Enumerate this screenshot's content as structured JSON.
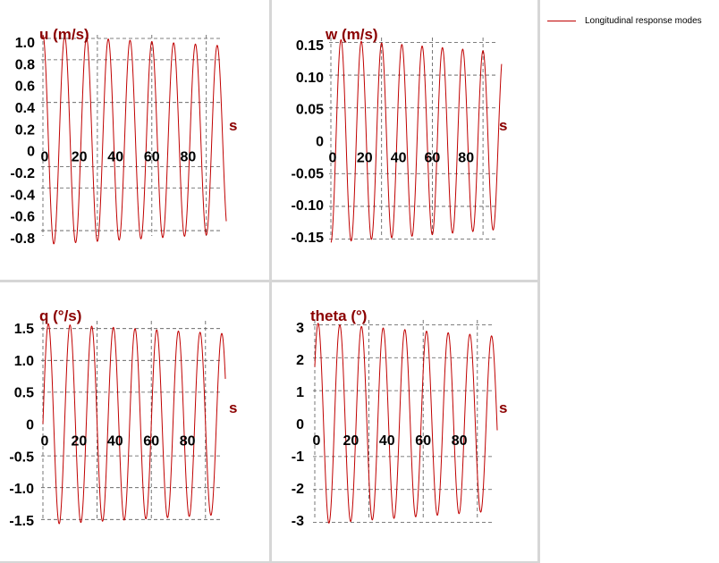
{
  "legend": {
    "label": "Longitudinal response modes",
    "color": "#c00000"
  },
  "style": {
    "title_color": "#8b0000",
    "line_color": "#c00000",
    "grid_color": "#555555",
    "tick_color": "#000000"
  },
  "charts": [
    {
      "id": "u",
      "chart_data": {
        "type": "line",
        "title": "u (m/s)",
        "xlabel": "s",
        "ylabel": "",
        "xlim": [
          0,
          100
        ],
        "ylim": [
          -1.0,
          1.0
        ],
        "xticks": [
          "0",
          "20",
          "40",
          "60",
          "80"
        ],
        "yticks": [
          "1.0",
          "0.8",
          "0.6",
          "0.4",
          "0.2",
          "0",
          "-0.2",
          "-0.4",
          "-0.6",
          "-0.8"
        ],
        "x_grid": [
          0,
          30,
          60,
          90
        ],
        "y_grid": [
          0.95,
          0.75,
          0.35,
          -0.25,
          -0.45,
          -0.85
        ],
        "series": [
          {
            "name": "Longitudinal response modes",
            "wave": {
              "amplitude_start": 0.98,
              "amplitude_end": 0.88,
              "period": 12.0,
              "phase": 1.571,
              "x_start": 0,
              "x_end": 101
            }
          }
        ]
      }
    },
    {
      "id": "w",
      "chart_data": {
        "type": "line",
        "title": "w (m/s)",
        "xlabel": "s",
        "ylabel": "",
        "xlim": [
          0,
          100
        ],
        "ylim": [
          -0.16,
          0.16
        ],
        "xticks": [
          "0",
          "20",
          "40",
          "60",
          "80"
        ],
        "yticks": [
          "0.15",
          "0.10",
          "0.05",
          "0",
          "-0.05",
          "-0.10",
          "-0.15"
        ],
        "x_grid": [
          0,
          30,
          60,
          90
        ],
        "y_grid": [
          0.15,
          0.1,
          0.05,
          -0.05,
          -0.1,
          -0.15
        ],
        "series": [
          {
            "name": "Longitudinal response modes",
            "wave": {
              "amplitude_start": 0.155,
              "amplitude_end": 0.135,
              "period": 12.0,
              "phase": -1.571,
              "x_start": 0,
              "x_end": 101
            }
          }
        ]
      }
    },
    {
      "id": "q",
      "chart_data": {
        "type": "line",
        "title": "q (°/s)",
        "xlabel": "s",
        "ylabel": "",
        "xlim": [
          0,
          100
        ],
        "ylim": [
          -1.65,
          1.65
        ],
        "xticks": [
          "0",
          "20",
          "40",
          "60",
          "80"
        ],
        "yticks": [
          "1.5",
          "1.0",
          "0.5",
          "0",
          "-0.5",
          "-1.0",
          "-1.5"
        ],
        "x_grid": [
          0,
          30,
          60,
          90
        ],
        "y_grid": [
          1.5,
          1.0,
          0.5,
          -0.5,
          -1.0,
          -1.5
        ],
        "series": [
          {
            "name": "Longitudinal response modes",
            "wave": {
              "amplitude_start": 1.58,
              "amplitude_end": 1.42,
              "period": 12.0,
              "phase": 0.0,
              "x_start": 0,
              "x_end": 101
            }
          }
        ]
      }
    },
    {
      "id": "theta",
      "chart_data": {
        "type": "line",
        "title": "theta (°)",
        "xlabel": "s",
        "ylabel": "",
        "xlim": [
          0,
          100
        ],
        "ylim": [
          -3.2,
          3.2
        ],
        "xticks": [
          "0",
          "20",
          "40",
          "60",
          "80"
        ],
        "yticks": [
          "3",
          "2",
          "1",
          "0",
          "-1",
          "-2",
          "-3"
        ],
        "x_grid": [
          0,
          30,
          60,
          90
        ],
        "y_grid": [
          3,
          2,
          1,
          -1,
          -2,
          -3
        ],
        "series": [
          {
            "name": "Longitudinal response modes",
            "wave": {
              "amplitude_start": 3.05,
              "amplitude_end": 2.65,
              "period": 12.0,
              "phase": 0.6,
              "x_start": 0,
              "x_end": 101
            }
          }
        ]
      }
    }
  ]
}
